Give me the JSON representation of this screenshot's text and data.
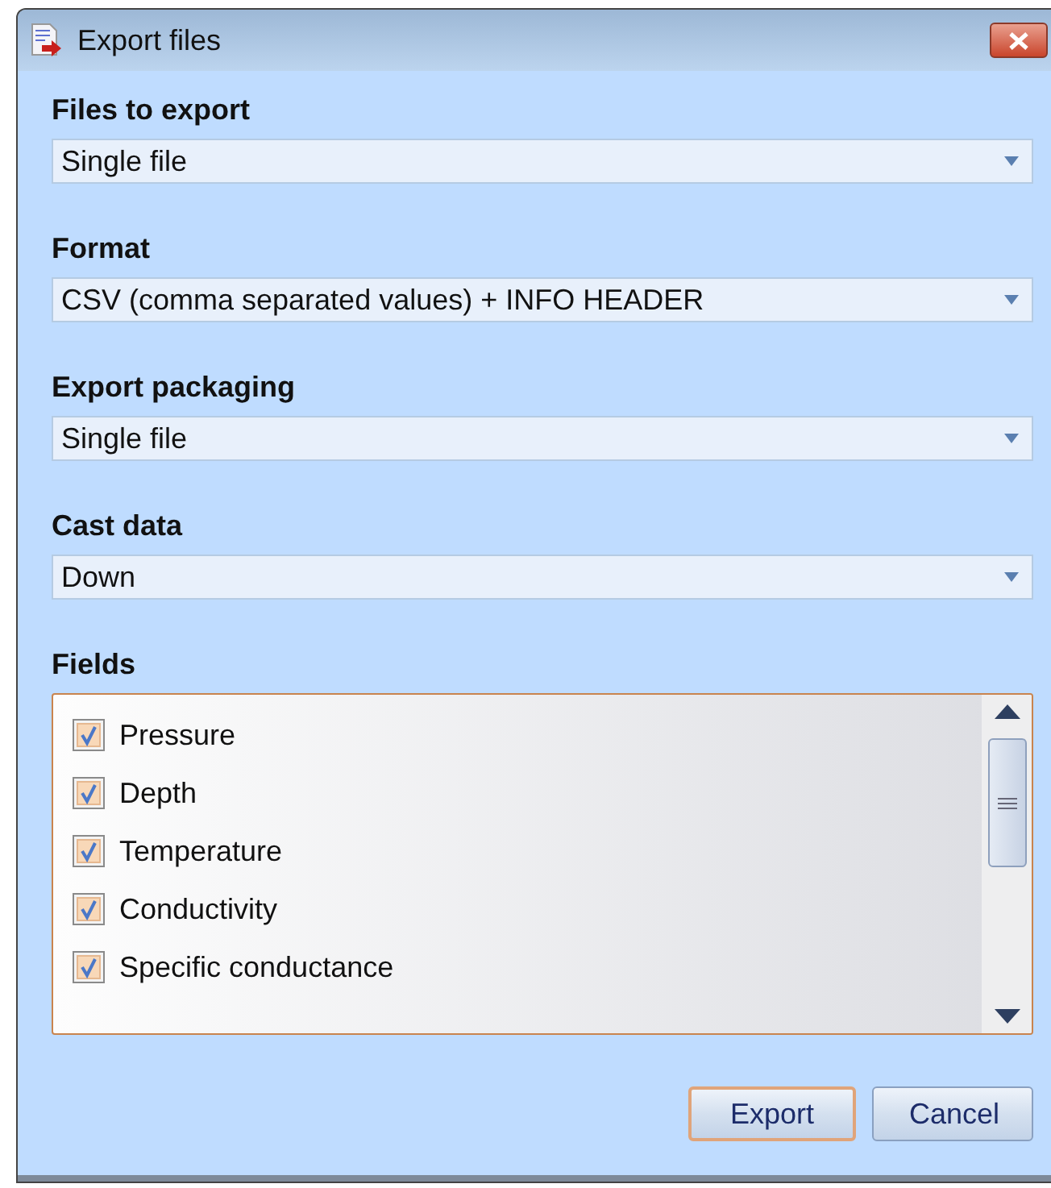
{
  "window": {
    "title": "Export files"
  },
  "sections": [
    {
      "label": "Files to export",
      "value": "Single file"
    },
    {
      "label": "Format",
      "value": "CSV (comma separated values) + INFO HEADER"
    },
    {
      "label": "Export packaging",
      "value": "Single file"
    },
    {
      "label": "Cast data",
      "value": "Down"
    }
  ],
  "fields": {
    "label": "Fields",
    "items": [
      {
        "name": "Pressure",
        "checked": true
      },
      {
        "name": "Depth",
        "checked": true
      },
      {
        "name": "Temperature",
        "checked": true
      },
      {
        "name": "Conductivity",
        "checked": true
      },
      {
        "name": "Specific conductance",
        "checked": true
      }
    ]
  },
  "buttons": [
    {
      "label": "Export",
      "default": true
    },
    {
      "label": "Cancel",
      "default": false
    }
  ]
}
